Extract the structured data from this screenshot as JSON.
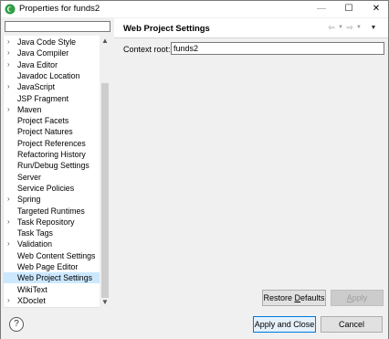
{
  "window": {
    "title": "Properties for funds2",
    "minimize": "—",
    "maximize": "☐",
    "close": "✕"
  },
  "filter": {
    "value": ""
  },
  "tree": {
    "items": [
      {
        "label": "Java Code Style",
        "expandable": true
      },
      {
        "label": "Java Compiler",
        "expandable": true
      },
      {
        "label": "Java Editor",
        "expandable": true
      },
      {
        "label": "Javadoc Location",
        "expandable": false
      },
      {
        "label": "JavaScript",
        "expandable": true
      },
      {
        "label": "JSP Fragment",
        "expandable": false
      },
      {
        "label": "Maven",
        "expandable": true
      },
      {
        "label": "Project Facets",
        "expandable": false
      },
      {
        "label": "Project Natures",
        "expandable": false
      },
      {
        "label": "Project References",
        "expandable": false
      },
      {
        "label": "Refactoring History",
        "expandable": false
      },
      {
        "label": "Run/Debug Settings",
        "expandable": false
      },
      {
        "label": "Server",
        "expandable": false
      },
      {
        "label": "Service Policies",
        "expandable": false
      },
      {
        "label": "Spring",
        "expandable": true
      },
      {
        "label": "Targeted Runtimes",
        "expandable": false
      },
      {
        "label": "Task Repository",
        "expandable": true
      },
      {
        "label": "Task Tags",
        "expandable": false
      },
      {
        "label": "Validation",
        "expandable": true
      },
      {
        "label": "Web Content Settings",
        "expandable": false
      },
      {
        "label": "Web Page Editor",
        "expandable": false
      },
      {
        "label": "Web Project Settings",
        "expandable": false,
        "selected": true
      },
      {
        "label": "WikiText",
        "expandable": false
      },
      {
        "label": "XDoclet",
        "expandable": true
      }
    ],
    "chevron": "›"
  },
  "page": {
    "title": "Web Project Settings",
    "context_root_label": "Context root:",
    "context_root_value": "funds2"
  },
  "nav": {
    "back": "⇦",
    "forward": "⇨",
    "dropdown": "▼",
    "view_menu": "▼"
  },
  "buttons": {
    "restore_defaults_prefix": "Restore ",
    "restore_defaults_mnemonic": "D",
    "restore_defaults_suffix": "efaults",
    "apply_mnemonic": "A",
    "apply_suffix": "pply",
    "apply_and_close": "Apply and Close",
    "cancel": "Cancel",
    "help": "?"
  },
  "colors": {
    "selection": "#cce8ff",
    "focus_border": "#0078d7"
  }
}
